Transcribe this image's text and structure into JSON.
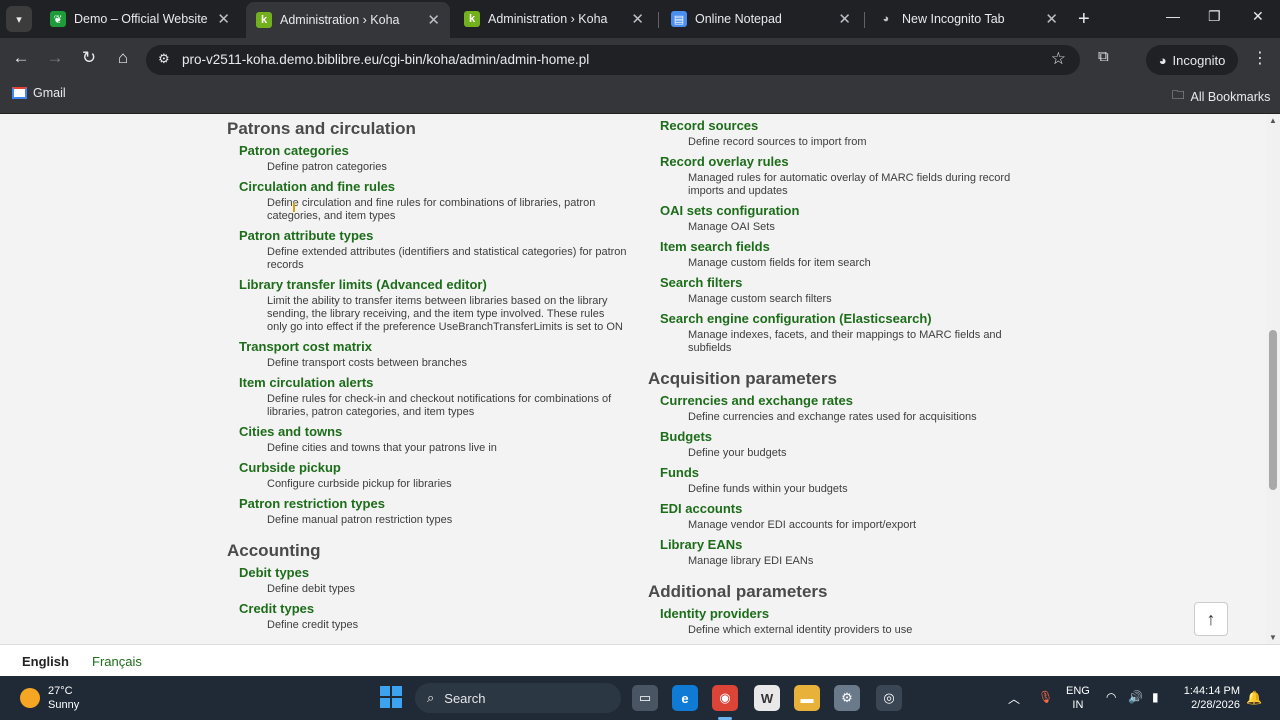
{
  "tabs": [
    {
      "title": "Demo – Official Website of K",
      "favicon": "koha-green-leaf",
      "active": false
    },
    {
      "title": "Administration › Koha",
      "favicon": "koha-k",
      "active": true
    },
    {
      "title": "Administration › Koha",
      "favicon": "koha-k",
      "active": false
    },
    {
      "title": "Online Notepad",
      "favicon": "notepad-doc",
      "active": false
    },
    {
      "title": "New Incognito Tab",
      "favicon": "incognito",
      "active": false
    }
  ],
  "address": {
    "url": "pro-v2511-koha.demo.biblibre.eu/cgi-bin/koha/admin/admin-home.pl"
  },
  "incognito_label": "Incognito",
  "bookmarks": {
    "gmail": "Gmail",
    "all": "All Bookmarks"
  },
  "left_column": {
    "sections": [
      {
        "title": "Patrons and circulation",
        "items": [
          {
            "name": "Patron categories",
            "desc": "Define patron categories"
          },
          {
            "name": "Circulation and fine rules",
            "desc": "Define circulation and fine rules for combinations of libraries, patron categories, and item types"
          },
          {
            "name": "Patron attribute types",
            "desc": "Define extended attributes (identifiers and statistical categories) for patron records"
          },
          {
            "name": "Library transfer limits (Advanced editor)",
            "desc": "Limit the ability to transfer items between libraries based on the library sending, the library receiving, and the item type involved. These rules only go into effect if the preference UseBranchTransferLimits is set to ON"
          },
          {
            "name": "Transport cost matrix",
            "desc": "Define transport costs between branches"
          },
          {
            "name": "Item circulation alerts",
            "desc": "Define rules for check-in and checkout notifications for combinations of libraries, patron categories, and item types"
          },
          {
            "name": "Cities and towns",
            "desc": "Define cities and towns that your patrons live in"
          },
          {
            "name": "Curbside pickup",
            "desc": "Configure curbside pickup for libraries"
          },
          {
            "name": "Patron restriction types",
            "desc": "Define manual patron restriction types"
          }
        ]
      },
      {
        "title": "Accounting",
        "items": [
          {
            "name": "Debit types",
            "desc": "Define debit types"
          },
          {
            "name": "Credit types",
            "desc": "Define credit types"
          }
        ]
      }
    ]
  },
  "right_column": {
    "sections": [
      {
        "title": "",
        "items": [
          {
            "name": "Record sources",
            "desc": "Define record sources to import from"
          },
          {
            "name": "Record overlay rules",
            "desc": "Managed rules for automatic overlay of MARC fields during record imports and updates"
          },
          {
            "name": "OAI sets configuration",
            "desc": "Manage OAI Sets"
          },
          {
            "name": "Item search fields",
            "desc": "Manage custom fields for item search"
          },
          {
            "name": "Search filters",
            "desc": "Manage custom search filters"
          },
          {
            "name": "Search engine configuration (Elasticsearch)",
            "desc": "Manage indexes, facets, and their mappings to MARC fields and subfields"
          }
        ]
      },
      {
        "title": "Acquisition parameters",
        "items": [
          {
            "name": "Currencies and exchange rates",
            "desc": "Define currencies and exchange rates used for acquisitions"
          },
          {
            "name": "Budgets",
            "desc": "Define your budgets"
          },
          {
            "name": "Funds",
            "desc": "Define funds within your budgets"
          },
          {
            "name": "EDI accounts",
            "desc": "Manage vendor EDI accounts for import/export"
          },
          {
            "name": "Library EANs",
            "desc": "Manage library EDI EANs"
          }
        ]
      },
      {
        "title": "Additional parameters",
        "items": [
          {
            "name": "Identity providers",
            "desc": "Define which external identity providers to use"
          }
        ]
      }
    ]
  },
  "languages": {
    "current": "English",
    "other": "Français"
  },
  "taskbar": {
    "weather_temp": "27°C",
    "weather_cond": "Sunny",
    "search_label": "Search",
    "lang_line1": "ENG",
    "lang_line2": "IN",
    "time": "1:44:14 PM",
    "date": "2/28/2026"
  },
  "colors": {
    "link_green": "#1d6d1a",
    "heading_gray": "#4a4a4a",
    "chrome_dark": "#202124"
  }
}
